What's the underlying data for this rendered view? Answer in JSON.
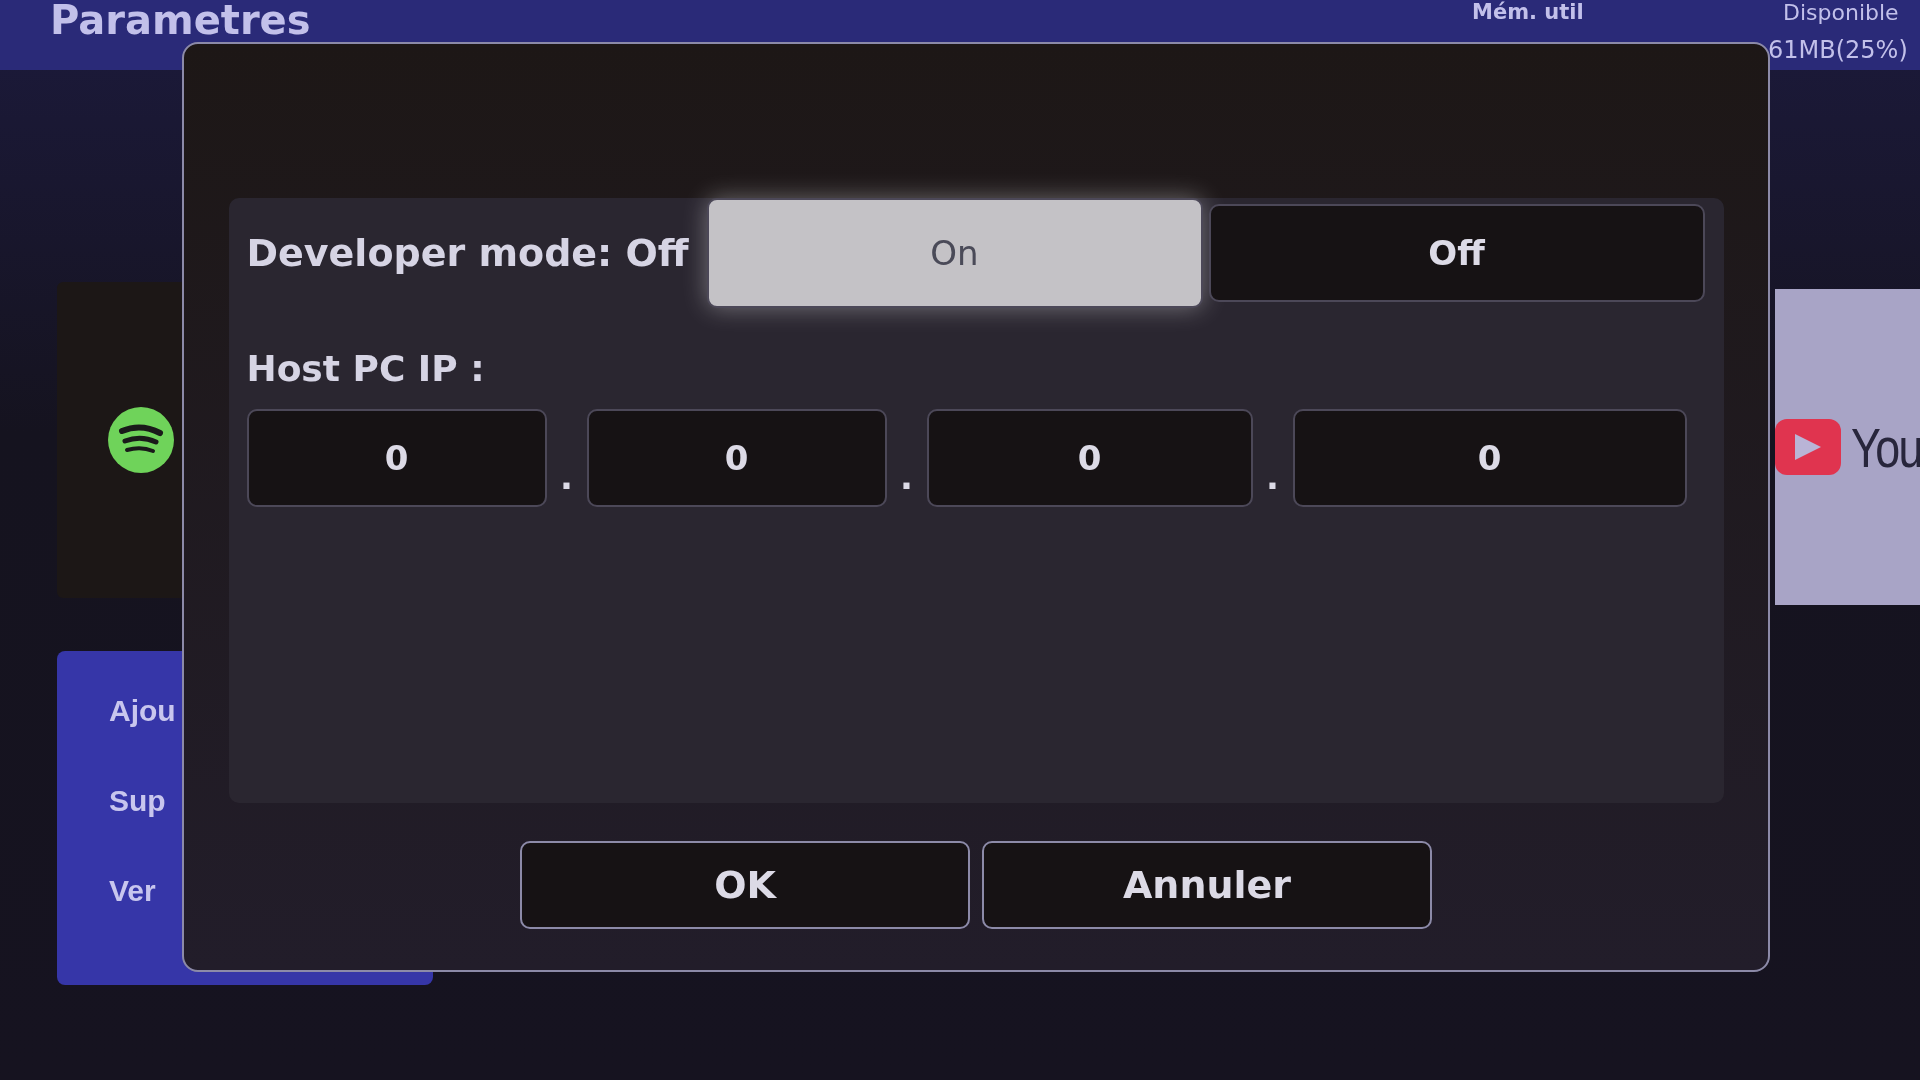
{
  "header": {
    "title": "Parametres",
    "memory_label": "Mém. util",
    "available_label": "Disponible",
    "available_value": "61MB(25%)"
  },
  "side_menu": {
    "items": [
      "Ajou",
      "Sup",
      "Ver"
    ]
  },
  "app_tile": {
    "label": "You"
  },
  "dialog": {
    "mode_label": "Developer mode: Off",
    "mode_options": [
      {
        "label": "On",
        "selected": true
      },
      {
        "label": "Off",
        "selected": false
      }
    ],
    "ip_label": "Host PC IP :",
    "ip_fields": [
      "0",
      "0",
      "0",
      "0"
    ],
    "ip_separators": [
      ".",
      ".",
      "."
    ],
    "buttons": [
      "OK",
      "Annuler"
    ]
  }
}
